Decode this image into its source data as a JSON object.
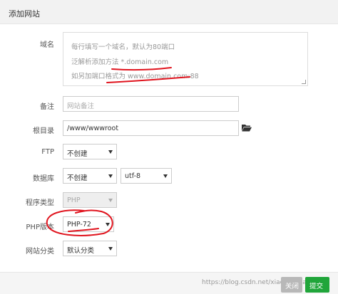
{
  "dialog": {
    "title": "添加网站"
  },
  "form": {
    "domain": {
      "label": "域名",
      "placeholder_lines": [
        "每行填写一个域名，默认为80端口",
        "泛解析添加方法 *.domain.com",
        "如另加端口格式为 www.domain.com:88"
      ]
    },
    "remark": {
      "label": "备注",
      "placeholder": "网站备注"
    },
    "root_dir": {
      "label": "根目录",
      "value": "/www/wwwroot",
      "icon": "folder-icon"
    },
    "ftp": {
      "label": "FTP",
      "selected": "不创建"
    },
    "database": {
      "label": "数据库",
      "selected": "不创建",
      "charset": "utf-8"
    },
    "program_type": {
      "label": "程序类型",
      "selected": "PHP"
    },
    "php_version": {
      "label": "PHP版本",
      "selected": "PHP-72"
    },
    "site_category": {
      "label": "网站分类",
      "selected": "默认分类"
    }
  },
  "footer": {
    "close_label": "关闭",
    "submit_label": "提交",
    "watermark": "https://blog.csdn.net/xiaoxiaoxiaoton"
  },
  "colors": {
    "submit_green": "#20a53a",
    "annotation_red": "#e0141e"
  }
}
